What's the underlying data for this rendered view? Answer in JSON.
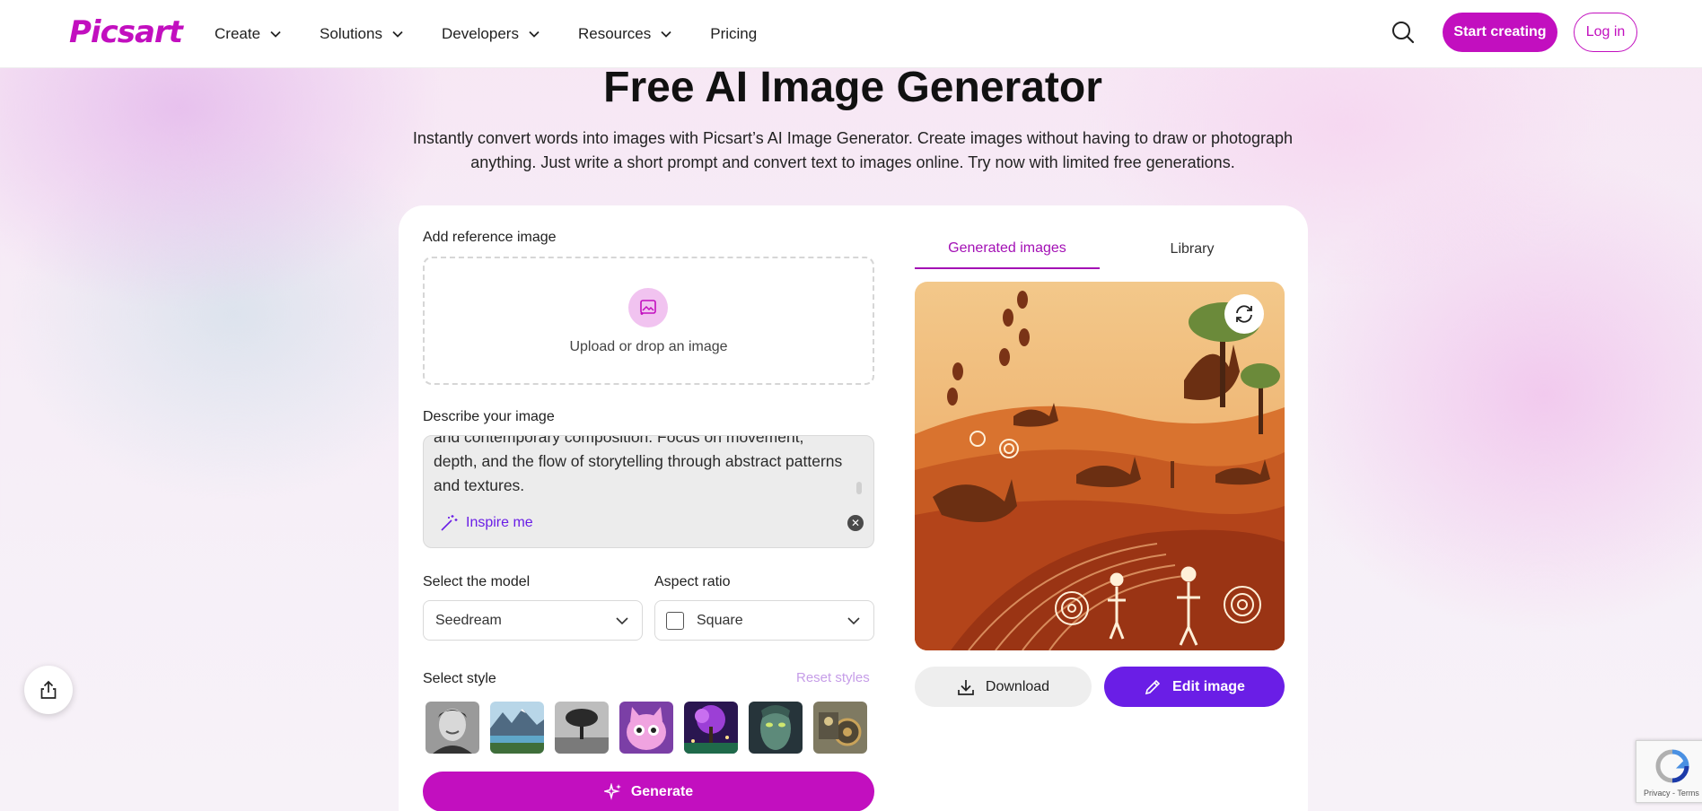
{
  "nav": {
    "logo": "Picsart",
    "items": [
      {
        "label": "Create"
      },
      {
        "label": "Solutions"
      },
      {
        "label": "Developers"
      },
      {
        "label": "Resources"
      },
      {
        "label": "Pricing"
      }
    ],
    "start_creating": "Start creating",
    "log_in": "Log in"
  },
  "hero": {
    "title": "Free AI Image Generator",
    "subtitle": "Instantly convert words into images with Picsart’s AI Image Generator. Create images without having to draw or photograph anything. Just write a short prompt and convert text to images online. Try now with limited free generations."
  },
  "form": {
    "reference_label": "Add reference image",
    "upload_text": "Upload or drop an image",
    "describe_label": "Describe your image",
    "prompt_value": "and contemporary composition. Focus on movement, depth, and the flow of storytelling through abstract patterns and textures.",
    "inspire_me": "Inspire me",
    "model_label": "Select the model",
    "model_value": "Seedream",
    "ratio_label": "Aspect ratio",
    "ratio_value": "Square",
    "style_label": "Select style",
    "reset_styles": "Reset styles",
    "generate": "Generate"
  },
  "styles": [
    {
      "name": "portrait-boy"
    },
    {
      "name": "mountain-lake"
    },
    {
      "name": "bw-tree"
    },
    {
      "name": "pink-creature"
    },
    {
      "name": "fantasy-forest"
    },
    {
      "name": "alien-face"
    },
    {
      "name": "steampunk"
    }
  ],
  "results": {
    "tabs": [
      {
        "label": "Generated images",
        "active": true
      },
      {
        "label": "Library",
        "active": false
      }
    ],
    "download": "Download",
    "edit_image": "Edit image"
  },
  "recaptcha": {
    "footer": "Privacy - Terms"
  },
  "colors": {
    "brand": "#c20fbf",
    "accent_purple": "#6a1ee6"
  }
}
